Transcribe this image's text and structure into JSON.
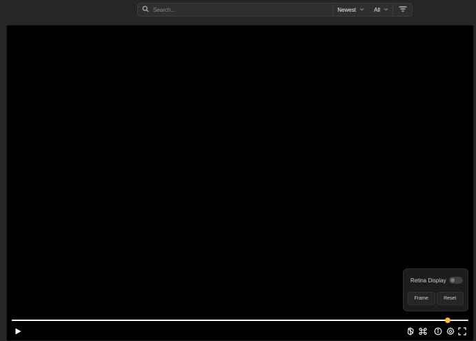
{
  "toolbar": {
    "search": {
      "placeholder": "Search...",
      "value": ""
    },
    "sort": {
      "selected": "Newest"
    },
    "filter": {
      "selected": "All"
    }
  },
  "player": {
    "progress": 0.955,
    "popover": {
      "retina_label": "Retina Display",
      "retina_enabled": false,
      "frame_label": "Frame",
      "reset_label": "Reset"
    },
    "controls": [
      "play-icon",
      "orbit-icon",
      "command-icon",
      "info-icon",
      "settings-icon",
      "fullscreen-icon"
    ],
    "colors": {
      "accent": "#ffb454",
      "background": "#000000",
      "surface": "#262626"
    }
  }
}
